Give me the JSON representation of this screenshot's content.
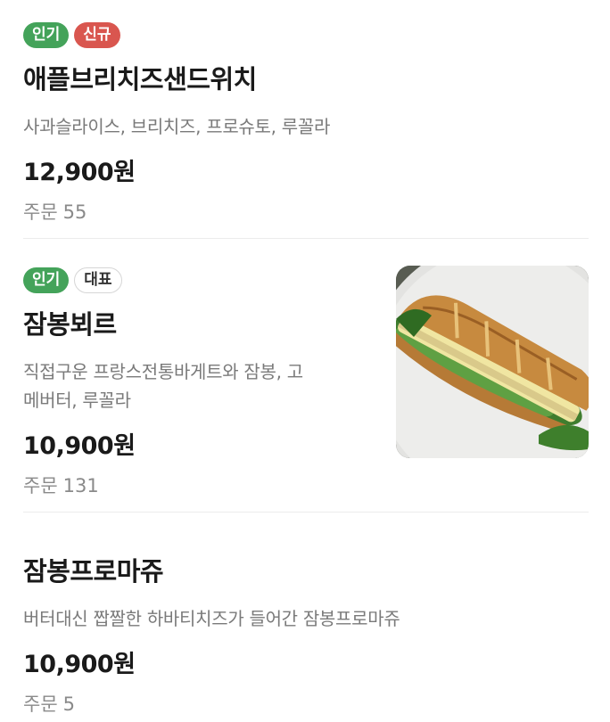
{
  "items": [
    {
      "badges": [
        "인기",
        "신규"
      ],
      "name": "애플브리치즈샌드위치",
      "description": "사과슬라이스, 브리치즈, 프로슈토, 루꼴라",
      "price": "12,900원",
      "orders_label": "주문",
      "orders_count": "55"
    },
    {
      "badges": [
        "인기",
        "대표"
      ],
      "name": "잠봉뵈르",
      "description_line1": "직접구운 프랑스전통바게트와 잠봉, 고",
      "description_line2": "메버터, 루꼴라",
      "price": "10,900원",
      "orders_label": "주문",
      "orders_count": "131",
      "image": "sandwich-photo"
    },
    {
      "name": "잠봉프로마쥬",
      "description": "버터대신 짭짤한 하바티치즈가 들어간 잠봉프로마쥬",
      "price": "10,900원",
      "orders_label": "주문",
      "orders_count": "5"
    }
  ],
  "colors": {
    "popular": "#44a35a",
    "new": "#d9564f",
    "signature_border": "#d6d6d6"
  }
}
